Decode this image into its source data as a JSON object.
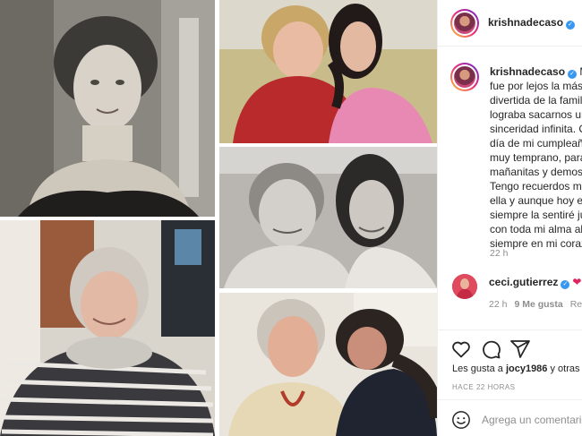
{
  "post": {
    "author": "krishnadecaso",
    "caption_lines": [
      "Mi",
      "fue por lejos la más l",
      "divertida de la famili",
      "lograba sacarnos una",
      "sinceridad infinita. Ca",
      "día de mi cumpleaño",
      "muy temprano, para",
      "mañanitas y demostr",
      "Tengo recuerdos me",
      "ella y aunque hoy es",
      "siempre la sentiré jur",
      "con toda mi alma ab",
      "siempre en mi corazo"
    ],
    "caption_time": "22 h"
  },
  "comment": {
    "user": "ceci.gutierrez",
    "emoji": "❤",
    "time": "22 h",
    "likes": "9 Me gusta",
    "reply": "Res"
  },
  "likes_line": {
    "prefix": "Les gusta a ",
    "user": "jocy1986",
    "suffix": " y otras"
  },
  "posted_ago": "HACE 22 HORAS",
  "add_comment_placeholder": "Agrega un comentario",
  "colors": {
    "verified": "#3897f0",
    "text": "#262626",
    "muted": "#8e8e8e",
    "heart": "#e0245e"
  },
  "icons": [
    "heart-icon",
    "comment-icon",
    "share-icon",
    "smile-icon",
    "verified-badge-icon"
  ]
}
